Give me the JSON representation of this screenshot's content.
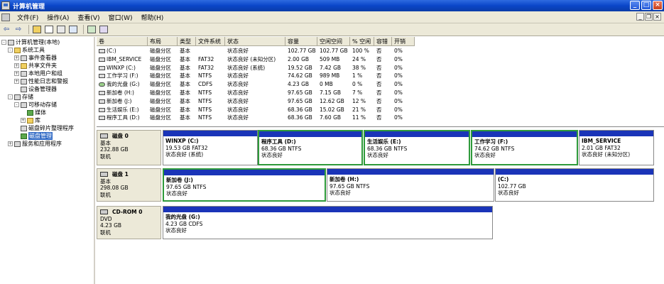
{
  "window": {
    "title": "计算机管理"
  },
  "menu": [
    "文件(F)",
    "操作(A)",
    "查看(V)",
    "窗口(W)",
    "帮助(H)"
  ],
  "tree": [
    {
      "label": "计算机管理(本地)",
      "depth": 0,
      "exp": "-",
      "icon": "computer"
    },
    {
      "label": "系统工具",
      "depth": 1,
      "exp": "-",
      "icon": "tools"
    },
    {
      "label": "事件查看器",
      "depth": 2,
      "exp": "+",
      "icon": "event"
    },
    {
      "label": "共享文件夹",
      "depth": 2,
      "exp": "+",
      "icon": "folder"
    },
    {
      "label": "本地用户和组",
      "depth": 2,
      "exp": "+",
      "icon": "users"
    },
    {
      "label": "性能日志和警报",
      "depth": 2,
      "exp": "+",
      "icon": "perf"
    },
    {
      "label": "设备管理器",
      "depth": 2,
      "exp": "",
      "icon": "device"
    },
    {
      "label": "存储",
      "depth": 1,
      "exp": "-",
      "icon": "storage"
    },
    {
      "label": "可移动存储",
      "depth": 2,
      "exp": "-",
      "icon": "removable"
    },
    {
      "label": "媒体",
      "depth": 3,
      "exp": "",
      "icon": "green"
    },
    {
      "label": "库",
      "depth": 3,
      "exp": "+",
      "icon": "folder"
    },
    {
      "label": "磁盘碎片整理程序",
      "depth": 2,
      "exp": "",
      "icon": "defrag"
    },
    {
      "label": "磁盘管理",
      "depth": 2,
      "exp": "",
      "icon": "diskmgmt",
      "selected": true
    },
    {
      "label": "服务和应用程序",
      "depth": 1,
      "exp": "+",
      "icon": "services"
    }
  ],
  "columns": [
    "卷",
    "布局",
    "类型",
    "文件系统",
    "状态",
    "容量",
    "空闲空间",
    "% 空闲",
    "容错",
    "开销"
  ],
  "volumes": [
    [
      "(C:)",
      "磁盘分区",
      "基本",
      "",
      "状态良好",
      "102.77 GB",
      "102.77 GB",
      "100 %",
      "否",
      "0%"
    ],
    [
      "IBM_SERVICE",
      "磁盘分区",
      "基本",
      "FAT32",
      "状态良好 (未知分区)",
      "2.00 GB",
      "509 MB",
      "24 %",
      "否",
      "0%"
    ],
    [
      "WINXP (C:)",
      "磁盘分区",
      "基本",
      "FAT32",
      "状态良好 (系统)",
      "19.52 GB",
      "7.42 GB",
      "38 %",
      "否",
      "0%"
    ],
    [
      "工作学习 (F:)",
      "磁盘分区",
      "基本",
      "NTFS",
      "状态良好",
      "74.62 GB",
      "989 MB",
      "1 %",
      "否",
      "0%"
    ],
    [
      "我的光盘 (G:)",
      "磁盘分区",
      "基本",
      "CDFS",
      "状态良好",
      "4.23 GB",
      "0 MB",
      "0 %",
      "否",
      "0%"
    ],
    [
      "新加卷 (H:)",
      "磁盘分区",
      "基本",
      "NTFS",
      "状态良好",
      "97.65 GB",
      "7.15 GB",
      "7 %",
      "否",
      "0%"
    ],
    [
      "新加卷 (J:)",
      "磁盘分区",
      "基本",
      "NTFS",
      "状态良好",
      "97.65 GB",
      "12.62 GB",
      "12 %",
      "否",
      "0%"
    ],
    [
      "生活娱乐 (E:)",
      "磁盘分区",
      "基本",
      "NTFS",
      "状态良好",
      "68.36 GB",
      "15.02 GB",
      "21 %",
      "否",
      "0%"
    ],
    [
      "程序工具 (D:)",
      "磁盘分区",
      "基本",
      "NTFS",
      "状态良好",
      "68.36 GB",
      "7.60 GB",
      "11 %",
      "否",
      "0%"
    ]
  ],
  "disks": [
    {
      "name": "磁盘 0",
      "type": "基本",
      "size": "232.88 GB",
      "status": "联机",
      "parts": [
        {
          "name": "WINXP (C:)",
          "size": "19.53 GB FAT32",
          "status": "状态良好 (系统)",
          "sel": false
        },
        {
          "name": "程序工具 (D:)",
          "size": "68.36 GB NTFS",
          "status": "状态良好",
          "sel": true
        },
        {
          "name": "生活娱乐 (E:)",
          "size": "68.36 GB NTFS",
          "status": "状态良好",
          "sel": true
        },
        {
          "name": "工作学习 (F:)",
          "size": "74.62 GB NTFS",
          "status": "状态良好",
          "sel": true
        },
        {
          "name": "IBM_SERVICE",
          "size": "2.01 GB FAT32",
          "status": "状态良好 (未知分区)",
          "sel": false
        }
      ]
    },
    {
      "name": "磁盘 1",
      "type": "基本",
      "size": "298.08 GB",
      "status": "联机",
      "parts": [
        {
          "name": "新加卷 (J:)",
          "size": "97.65 GB NTFS",
          "status": "状态良好",
          "sel": true
        },
        {
          "name": "新加卷 (H:)",
          "size": "97.65 GB NTFS",
          "status": "状态良好",
          "sel": false
        },
        {
          "name": "(C:)",
          "size": "102.77 GB",
          "status": "状态良好",
          "sel": false
        }
      ]
    },
    {
      "name": "CD-ROM 0",
      "type": "DVD",
      "size": "4.23 GB",
      "status": "联机",
      "parts": [
        {
          "name": "我的光盘 (G:)",
          "size": "4.23 GB CDFS",
          "status": "状态良好",
          "sel": false
        }
      ]
    }
  ]
}
